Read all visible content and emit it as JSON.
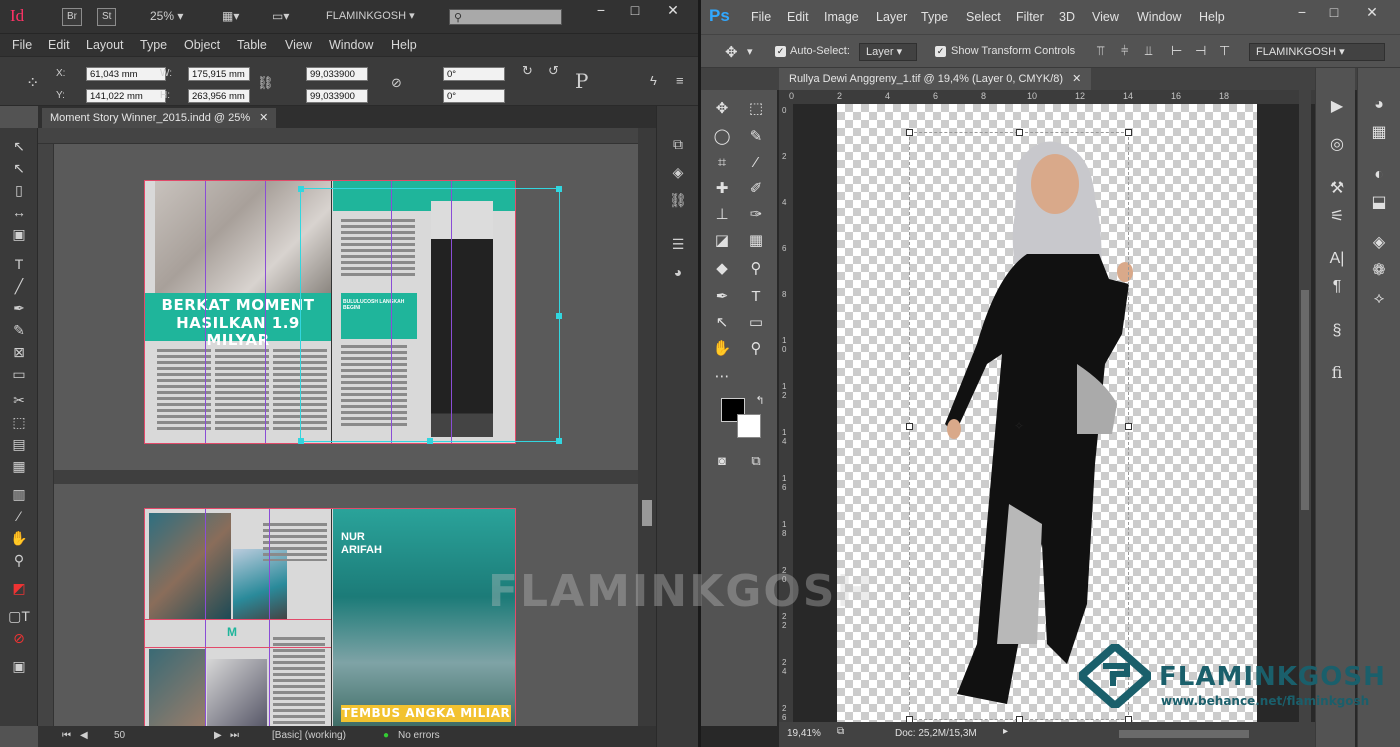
{
  "indesign": {
    "logo": "Id",
    "bridge_btn": "Br",
    "stock_btn": "St",
    "zoom": "25%",
    "workspace": "FLAMINKGOSH",
    "menu": [
      "File",
      "Edit",
      "Layout",
      "Type",
      "Object",
      "Table",
      "View",
      "Window",
      "Help"
    ],
    "control": {
      "x_label": "X:",
      "x_value": "61,043 mm",
      "y_label": "Y:",
      "y_value": "141,022 mm",
      "w_label": "W:",
      "w_value": "175,915 mm",
      "h_label": "H:",
      "h_value": "263,956 mm",
      "scale_x": "99,033900",
      "scale_y": "99,033900",
      "rotate": "0°",
      "shear": "0°"
    },
    "doc_tab": "Moment Story Winner_2015.indd @ 25%",
    "spread1": {
      "headline_line1": "BERKAT MOMENT",
      "headline_line2": "HASILKAN 1.9 MILYAR",
      "small_tag": "BULULUCOSH LANGKAH BEGINI"
    },
    "spread2": {
      "name_line1": "NUR",
      "name_line2": "ARIFAH",
      "headline": "TEMBUS ANGKA MILIAR",
      "drop_cap": "M"
    },
    "status": {
      "page": "50",
      "style": "[Basic] (working)",
      "preflight": "No errors"
    }
  },
  "photoshop": {
    "logo": "Ps",
    "menu": [
      "File",
      "Edit",
      "Image",
      "Layer",
      "Type",
      "Select",
      "Filter",
      "3D",
      "View",
      "Window",
      "Help"
    ],
    "options": {
      "auto_select_label": "Auto-Select:",
      "auto_select_target": "Layer",
      "transform_controls_label": "Show Transform Controls",
      "workspace": "FLAMINKGOSH"
    },
    "doc_tab": "Rullya Dewi Anggreny_1.tif @ 19,4% (Layer 0, CMYK/8)",
    "ruler_h": [
      "0",
      "2",
      "4",
      "6",
      "8",
      "10",
      "12",
      "14",
      "16",
      "18"
    ],
    "ruler_v": [
      "0",
      "2",
      "4",
      "6",
      "8",
      "1\n0",
      "1\n2",
      "1\n4",
      "1\n6",
      "1\n8",
      "2\n0",
      "2\n2",
      "2\n4",
      "2\n6"
    ],
    "status": {
      "zoom": "19,41%",
      "doc": "Doc: 25,2M/15,3M"
    }
  },
  "branding": {
    "name": "FLAMINKGOSH",
    "url": "www.behance.net/flaminkgosh",
    "watermark": "FLAMINKGOSH",
    "accent": "#1a5f6b"
  }
}
